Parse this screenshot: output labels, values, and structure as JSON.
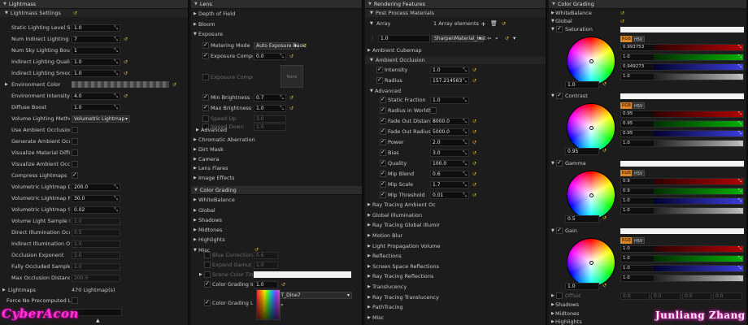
{
  "p1": {
    "title": "Lightmass",
    "section": "Lightmass Settings",
    "rows": [
      {
        "label": "Static Lighting Level Sca",
        "value": "1.0"
      },
      {
        "label": "Num Indirect Lighting Bo",
        "value": "7"
      },
      {
        "label": "Num Sky Lighting Bounc",
        "value": "1"
      },
      {
        "label": "Indirect Lighting Quality",
        "value": "1.0"
      },
      {
        "label": "Indirect Lighting Smooth",
        "value": "1.0"
      },
      {
        "label": "Environment Color",
        "value": ""
      },
      {
        "label": "Environment Intensity",
        "value": "4.0"
      },
      {
        "label": "Diffuse Boost",
        "value": "1.0"
      },
      {
        "label": "Volume Lighting Method",
        "value": "Volumetric Lightmap"
      },
      {
        "label": "Use Ambient Occlusion",
        "value": ""
      },
      {
        "label": "Generate Ambient Occlu",
        "value": ""
      },
      {
        "label": "Visualize Material Diffus",
        "value": ""
      },
      {
        "label": "Visualize Ambient Occlu",
        "value": ""
      },
      {
        "label": "Compress Lightmaps",
        "value": ""
      },
      {
        "label": "Volumetric Lightmap De",
        "value": "200.0"
      },
      {
        "label": "Volumetric Lightmap Ma",
        "value": "30.0"
      },
      {
        "label": "Volumetric Lightmap Sp",
        "value": "0.02"
      },
      {
        "label": "Volume Light Sample Pl",
        "value": "1.0"
      },
      {
        "label": "Direct Illumination Occlu",
        "value": "0.5"
      },
      {
        "label": "Indirect Illumination Occ",
        "value": "1.0"
      },
      {
        "label": "Occlusion Exponent",
        "value": "1.0"
      },
      {
        "label": "Fully Occluded Samples",
        "value": "1.0"
      },
      {
        "label": "Max Occlusion Distance",
        "value": "200.0"
      }
    ],
    "lightmaps_label": "Lightmaps",
    "lightmaps_count": "470 Lightmap(s)",
    "force_label": "Force No Precomputed Lig",
    "logo": "CyberAcon"
  },
  "p2": {
    "title": "Lens",
    "groups_top": [
      "Depth of Field",
      "Bloom",
      "Exposure"
    ],
    "exposure_rows": [
      {
        "label": "Metering Mode",
        "value": "Auto Exposure Basic"
      },
      {
        "label": "Exposure Compens",
        "value": "0.0"
      },
      {
        "label": "Exposure Compensatio",
        "value": "None"
      },
      {
        "label": "Min Brightness",
        "value": "0.7"
      },
      {
        "label": "Max Brightness",
        "value": "1.0"
      },
      {
        "label": "Speed Up",
        "value": "3.0"
      },
      {
        "label": "Speed Down",
        "value": "1.0"
      }
    ],
    "groups_mid": [
      "Advanced",
      "Chromatic Aberration",
      "Dirt Mask",
      "Camera",
      "Lens Flares",
      "Image Effects"
    ],
    "cg_title": "Color Grading",
    "cg_groups": [
      "WhiteBalance",
      "Global",
      "Shadows",
      "Midtones",
      "Highlights",
      "Misc"
    ],
    "misc_rows": [
      {
        "label": "Blue Correction",
        "value": "0.6"
      },
      {
        "label": "Expand Gamut",
        "value": "1.0"
      },
      {
        "label": "Scene Color Tint",
        "value": ""
      },
      {
        "label": "Color Grading Int",
        "value": "1.0"
      },
      {
        "label": "Color Grading LUT",
        "value": "LUT_Dine7"
      }
    ]
  },
  "p3": {
    "title": "Rendering Features",
    "ppm": "Post Process Materials",
    "array_label": "Array",
    "array_elements": "1 Array elements",
    "array_value": "1.0",
    "array_material": "SharpenMaterial_Inst",
    "ao_title": "Ambient Cubemap",
    "ao_section": "Ambient Occlusion",
    "ao_rows": [
      {
        "label": "Intensity",
        "value": "1.0"
      },
      {
        "label": "Radius",
        "value": "157.214563"
      }
    ],
    "advanced": "Advanced",
    "adv_rows": [
      {
        "label": "Static Fraction",
        "value": "1.0"
      },
      {
        "label": "Radius in WorldSpa",
        "value": ""
      },
      {
        "label": "Fade Out Distanc",
        "value": "8000.0"
      },
      {
        "label": "Fade Out Radius",
        "value": "5000.0"
      },
      {
        "label": "Power",
        "value": "2.0"
      },
      {
        "label": "Bias",
        "value": "3.0"
      },
      {
        "label": "Quality",
        "value": "100.0"
      },
      {
        "label": "Mip Blend",
        "value": "0.6"
      },
      {
        "label": "Mip Scale",
        "value": "1.7"
      },
      {
        "label": "Mip Threshold",
        "value": "0.01"
      }
    ],
    "groups": [
      "Ray Tracing Ambient Oc",
      "Global Illumination",
      "Ray Tracing Global Illumir",
      "Motion Blur",
      "Light Propagation Volume",
      "Reflections",
      "Screen Space Reflections",
      "Ray Tracing Reflections",
      "Translucency",
      "Ray Tracing Translucency",
      "PathTracing",
      "Misc"
    ]
  },
  "p4": {
    "title": "Color Grading",
    "white_balance": "WhiteBalance",
    "global": "Global",
    "wheels": [
      {
        "name": "Saturation",
        "r": "0.993753",
        "g": "1.0",
        "b": "0.949273",
        "y": "1.0",
        "base": "1.0"
      },
      {
        "name": "Contrast",
        "r": "0.95",
        "g": "0.95",
        "b": "0.95",
        "y": "1.0",
        "base": "0.95"
      },
      {
        "name": "Gamma",
        "r": "0.9",
        "g": "0.9",
        "b": "1.0",
        "y": "1.0",
        "base": "0.5"
      },
      {
        "name": "Gain",
        "r": "1.0",
        "g": "1.0",
        "b": "1.0",
        "y": "1.0",
        "base": "1.0"
      }
    ],
    "offset": "Offset",
    "offset_vals": [
      "0.0",
      "0.0",
      "0.0",
      "0.0"
    ],
    "rgb": "RGB",
    "hsv": "HSV",
    "groups": [
      "Shadows",
      "Midtones",
      "Highlights"
    ],
    "logo": "Junliang Zhang"
  },
  "colors": {
    "reset": "#e8c23a",
    "rgb_active": "#d9862a",
    "neon_pink": "#ff35d8"
  }
}
